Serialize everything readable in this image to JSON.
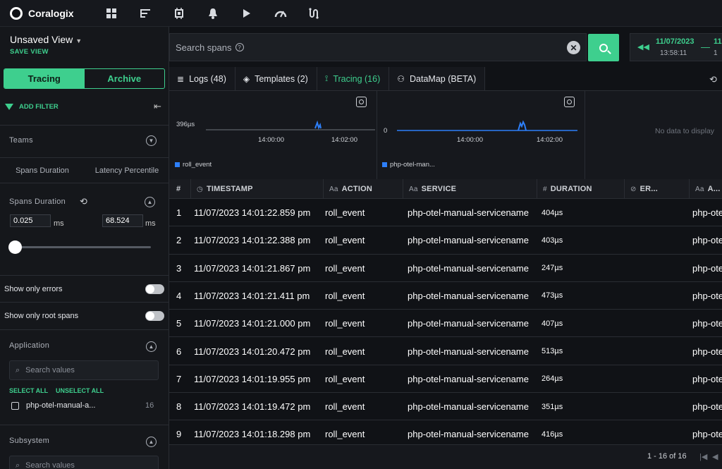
{
  "app": {
    "name": "Coralogix"
  },
  "topnav": [
    {
      "icon": "dashboard-grid-icon",
      "glyph": "▦"
    },
    {
      "icon": "explore-list-icon",
      "glyph": "☰"
    },
    {
      "icon": "cpu-chip-icon",
      "glyph": "⚙"
    },
    {
      "icon": "alerts-bell-icon",
      "glyph": "🔔"
    },
    {
      "icon": "play-icon",
      "glyph": "▶"
    },
    {
      "icon": "gauge-icon",
      "glyph": "◔"
    },
    {
      "icon": "flows-icon",
      "glyph": "∿"
    }
  ],
  "left": {
    "view_title": "Unsaved View",
    "save_view": "SAVE VIEW",
    "modes": [
      "Tracing",
      "Archive"
    ],
    "add_filter": "ADD FILTER",
    "teams_label": "Teams",
    "subtabs": [
      "Spans Duration",
      "Latency Percentile"
    ],
    "spans_duration_label": "Spans Duration",
    "min_value": "0.025",
    "max_value": "68.524",
    "unit": "ms",
    "slider_position": 0,
    "show_only_errors": "Show only errors",
    "show_only_root_spans": "Show only root spans",
    "application_label": "Application",
    "search_placeholder": "Search values",
    "select_all": "SELECT ALL",
    "unselect_all": "UNSELECT ALL",
    "app_item": "php-otel-manual-a...",
    "app_count": "16",
    "subsystem_label": "Subsystem"
  },
  "search": {
    "placeholder": "Search spans"
  },
  "time": {
    "from_date": "11/07/2023",
    "from_time": "13:58:11",
    "to_date": "11",
    "to_time": "1"
  },
  "tabs": [
    {
      "label": "Logs (48)",
      "icon": "logs-icon",
      "glyph": "≣",
      "active": false
    },
    {
      "label": "Templates (2)",
      "icon": "templates-layers-icon",
      "glyph": "◈",
      "active": false
    },
    {
      "label": "Tracing (16)",
      "icon": "tracing-icon",
      "glyph": "⟟",
      "active": true
    },
    {
      "label": "DataMap (BETA)",
      "icon": "datamap-icon",
      "glyph": "⚇",
      "active": false
    }
  ],
  "charts": {
    "panel1": {
      "y_label": "396µs",
      "x_ticks": [
        "14:00:00",
        "14:02:00"
      ],
      "legend": "roll_event"
    },
    "panel2": {
      "y_label": "0",
      "x_ticks": [
        "14:00:00",
        "14:02:00"
      ],
      "legend": "php-otel-man..."
    },
    "panel3": {
      "no_data": "No data to display"
    }
  },
  "table": {
    "headers": {
      "index": "#",
      "timestamp": "TIMESTAMP",
      "action": "ACTION",
      "service": "SERVICE",
      "duration": "DURATION",
      "errors": "ER...",
      "more": "A..."
    },
    "header_icons": {
      "timestamp": "clock-icon",
      "action": "text-type-icon",
      "service": "text-type-icon",
      "duration": "number-hash-icon",
      "errors": "error-icon",
      "more": "text-type-icon"
    },
    "rows": [
      {
        "n": "1",
        "ts": "11/07/2023 14:01:22.859 pm",
        "action": "roll_event",
        "service": "php-otel-manual-servicename",
        "duration": "404µs",
        "more": "php-ote"
      },
      {
        "n": "2",
        "ts": "11/07/2023 14:01:22.388 pm",
        "action": "roll_event",
        "service": "php-otel-manual-servicename",
        "duration": "403µs",
        "more": "php-ote"
      },
      {
        "n": "3",
        "ts": "11/07/2023 14:01:21.867 pm",
        "action": "roll_event",
        "service": "php-otel-manual-servicename",
        "duration": "247µs",
        "more": "php-ote"
      },
      {
        "n": "4",
        "ts": "11/07/2023 14:01:21.411 pm",
        "action": "roll_event",
        "service": "php-otel-manual-servicename",
        "duration": "473µs",
        "more": "php-ote"
      },
      {
        "n": "5",
        "ts": "11/07/2023 14:01:21.000 pm",
        "action": "roll_event",
        "service": "php-otel-manual-servicename",
        "duration": "407µs",
        "more": "php-ote"
      },
      {
        "n": "6",
        "ts": "11/07/2023 14:01:20.472 pm",
        "action": "roll_event",
        "service": "php-otel-manual-servicename",
        "duration": "513µs",
        "more": "php-ote"
      },
      {
        "n": "7",
        "ts": "11/07/2023 14:01:19.955 pm",
        "action": "roll_event",
        "service": "php-otel-manual-servicename",
        "duration": "264µs",
        "more": "php-ote"
      },
      {
        "n": "8",
        "ts": "11/07/2023 14:01:19.472 pm",
        "action": "roll_event",
        "service": "php-otel-manual-servicename",
        "duration": "351µs",
        "more": "php-ote"
      },
      {
        "n": "9",
        "ts": "11/07/2023 14:01:18.298 pm",
        "action": "roll_event",
        "service": "php-otel-manual-servicename",
        "duration": "416µs",
        "more": "php-ote"
      }
    ]
  },
  "pager": {
    "text": "1 - 16 of 16"
  },
  "colors": {
    "accent": "#3ecf8e",
    "series": "#2d7ff9"
  }
}
